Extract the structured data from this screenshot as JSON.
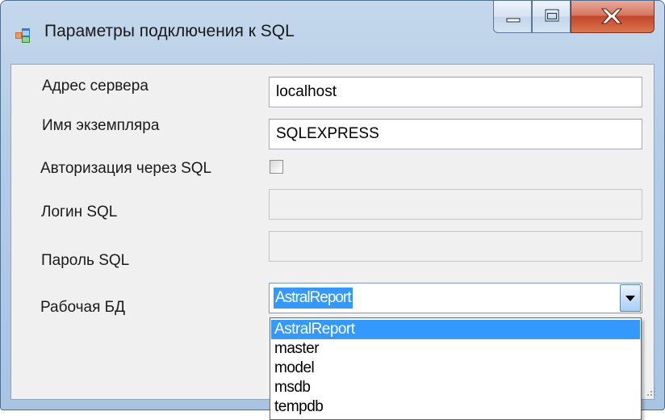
{
  "window": {
    "title": "Параметры подключения к SQL",
    "icon": "app-form-icon",
    "controls": {
      "minimize": "minimize-icon",
      "maximize": "maximize-icon",
      "close": "close-icon"
    }
  },
  "form": {
    "server_address": {
      "label": "Адрес сервера",
      "value": "localhost"
    },
    "instance_name": {
      "label": "Имя экземпляра",
      "value": "SQLEXPRESS"
    },
    "sql_auth": {
      "label": "Авторизация через SQL",
      "checked": false
    },
    "sql_login": {
      "label": "Логин SQL",
      "value": "",
      "enabled": false
    },
    "sql_password": {
      "label": "Пароль SQL",
      "value": "",
      "enabled": false
    },
    "database": {
      "label": "Рабочая БД",
      "selected": "AstralReport",
      "options": [
        "AstralReport",
        "master",
        "model",
        "msdb",
        "tempdb"
      ]
    }
  },
  "colors": {
    "selection": "#3399ff",
    "close_button": "#c4462a",
    "frame": "#b3cbe6"
  }
}
